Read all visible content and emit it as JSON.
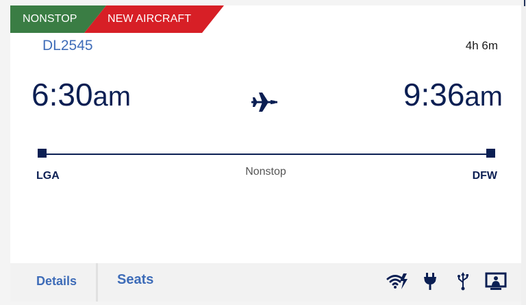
{
  "badges": {
    "nonstop": "NONSTOP",
    "new_aircraft": "NEW AIRCRAFT"
  },
  "flight": {
    "number": "DL2545",
    "duration": "4h 6m",
    "departure": {
      "time": "6:30",
      "ampm": "am",
      "airport": "LGA"
    },
    "arrival": {
      "time": "9:36",
      "ampm": "am",
      "airport": "DFW"
    },
    "stops": "Nonstop"
  },
  "footer": {
    "details_label": "Details",
    "seats_label": "Seats",
    "amenities": [
      "wifi-icon",
      "power-outlet-icon",
      "usb-icon",
      "personal-screen-icon"
    ]
  },
  "colors": {
    "nonstop_badge": "#3a7d44",
    "new_aircraft_badge": "#d71f26",
    "primary_navy": "#0b1f53",
    "link_blue": "#3e6cb8"
  }
}
